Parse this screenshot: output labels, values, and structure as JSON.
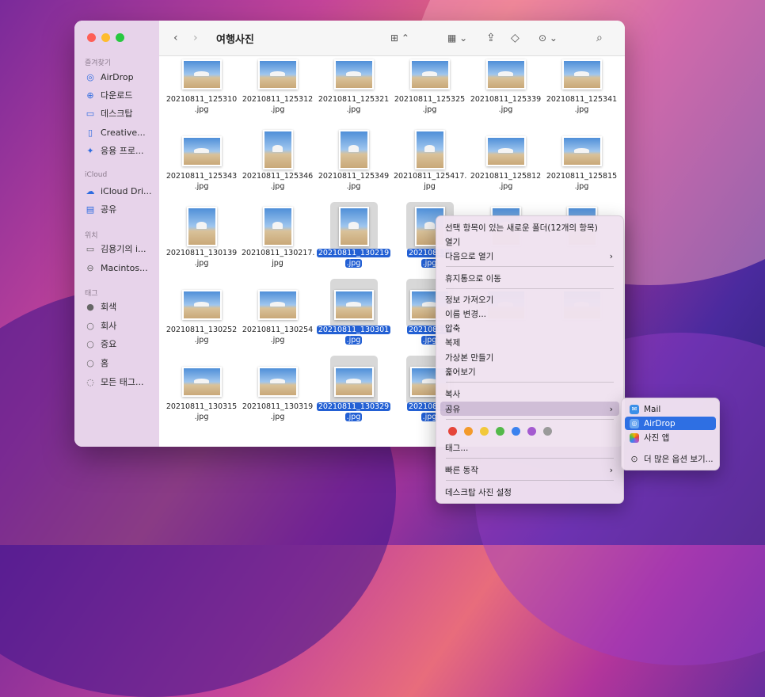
{
  "window": {
    "title": "여행사진"
  },
  "sidebar": {
    "sections": [
      {
        "label": "즐겨찾기",
        "items": [
          {
            "label": "AirDrop",
            "icon": "airdrop-icon"
          },
          {
            "label": "다운로드",
            "icon": "download-icon"
          },
          {
            "label": "데스크탑",
            "icon": "desktop-icon"
          },
          {
            "label": "Creative...",
            "icon": "document-icon"
          },
          {
            "label": "응용 프로...",
            "icon": "applications-icon"
          }
        ]
      },
      {
        "label": "iCloud",
        "items": [
          {
            "label": "iCloud Dri...",
            "icon": "cloud-icon"
          },
          {
            "label": "공유",
            "icon": "shared-folder-icon"
          }
        ]
      },
      {
        "label": "위치",
        "items": [
          {
            "label": "김용기의 i...",
            "icon": "computer-icon"
          },
          {
            "label": "Macintos...",
            "icon": "disk-icon"
          }
        ]
      },
      {
        "label": "태그",
        "items": [
          {
            "label": "회색",
            "icon": "tag-dot-gray-icon"
          },
          {
            "label": "회사",
            "icon": "tag-dot-empty-icon"
          },
          {
            "label": "중요",
            "icon": "tag-dot-empty-icon"
          },
          {
            "label": "홈",
            "icon": "tag-dot-empty-icon"
          },
          {
            "label": "모든 태그...",
            "icon": "all-tags-icon"
          }
        ]
      }
    ]
  },
  "files": [
    {
      "name1": "20210811_125310",
      "name2": ".jpg",
      "selected": false,
      "orient": "landscape"
    },
    {
      "name1": "20210811_125312",
      "name2": ".jpg",
      "selected": false,
      "orient": "landscape"
    },
    {
      "name1": "20210811_125321",
      "name2": ".jpg",
      "selected": false,
      "orient": "landscape"
    },
    {
      "name1": "20210811_125325",
      "name2": ".jpg",
      "selected": false,
      "orient": "landscape"
    },
    {
      "name1": "20210811_125339",
      "name2": ".jpg",
      "selected": false,
      "orient": "landscape"
    },
    {
      "name1": "20210811_125341",
      "name2": ".jpg",
      "selected": false,
      "orient": "landscape"
    },
    {
      "name1": "20210811_125343",
      "name2": ".jpg",
      "selected": false,
      "orient": "landscape"
    },
    {
      "name1": "20210811_125346",
      "name2": ".jpg",
      "selected": false,
      "orient": "portrait"
    },
    {
      "name1": "20210811_125349",
      "name2": ".jpg",
      "selected": false,
      "orient": "portrait"
    },
    {
      "name1": "20210811_125417.",
      "name2": "jpg",
      "selected": false,
      "orient": "portrait"
    },
    {
      "name1": "20210811_125812",
      "name2": ".jpg",
      "selected": false,
      "orient": "landscape"
    },
    {
      "name1": "20210811_125815",
      "name2": ".jpg",
      "selected": false,
      "orient": "landscape"
    },
    {
      "name1": "20210811_130139",
      "name2": ".jpg",
      "selected": false,
      "orient": "portrait"
    },
    {
      "name1": "20210811_130217.",
      "name2": "jpg",
      "selected": false,
      "orient": "portrait"
    },
    {
      "name1": "20210811_130219",
      "name2": ".jpg",
      "selected": true,
      "orient": "portrait"
    },
    {
      "name1": "20210811_",
      "name2": ".jpg",
      "selected": true,
      "orient": "portrait"
    },
    {
      "name1": "",
      "name2": "",
      "selected": false,
      "orient": "portrait"
    },
    {
      "name1": "",
      "name2": "",
      "selected": false,
      "orient": "portrait"
    },
    {
      "name1": "20210811_130252",
      "name2": ".jpg",
      "selected": false,
      "orient": "landscape"
    },
    {
      "name1": "20210811_130254",
      "name2": ".jpg",
      "selected": false,
      "orient": "landscape"
    },
    {
      "name1": "20210811_130301",
      "name2": ".jpg",
      "selected": true,
      "orient": "landscape"
    },
    {
      "name1": "20210811_",
      "name2": ".jpg",
      "selected": true,
      "orient": "landscape"
    },
    {
      "name1": "",
      "name2": "",
      "selected": false,
      "orient": "landscape"
    },
    {
      "name1": "",
      "name2": "",
      "selected": false,
      "orient": "landscape"
    },
    {
      "name1": "20210811_130315",
      "name2": ".jpg",
      "selected": false,
      "orient": "landscape"
    },
    {
      "name1": "20210811_130319",
      "name2": ".jpg",
      "selected": false,
      "orient": "landscape"
    },
    {
      "name1": "20210811_130329",
      "name2": ".jpg",
      "selected": true,
      "orient": "landscape"
    },
    {
      "name1": "20210811_",
      "name2": ".jpg",
      "selected": true,
      "orient": "landscape"
    }
  ],
  "context_menu": {
    "items": [
      {
        "label": "선택 항목이 있는 새로운 폴더(12개의 항목)"
      },
      {
        "label": "열기"
      },
      {
        "label": "다음으로 열기",
        "submenu": true
      },
      {
        "label": "휴지통으로 이동"
      },
      {
        "label": "정보 가져오기"
      },
      {
        "label": "이름 변경..."
      },
      {
        "label": "압축"
      },
      {
        "label": "복제"
      },
      {
        "label": "가상본 만들기"
      },
      {
        "label": "훑어보기"
      },
      {
        "label": "복사"
      },
      {
        "label": "공유",
        "submenu": true,
        "highlighted": true
      },
      {
        "label": "태그..."
      },
      {
        "label": "빠른 동작",
        "submenu": true
      },
      {
        "label": "데스크탑 사진 설정"
      }
    ],
    "tag_colors": [
      "#e5453a",
      "#f39a2b",
      "#f2c83a",
      "#53b94a",
      "#3b82ef",
      "#a45ad0",
      "#9a9a9a"
    ]
  },
  "share_submenu": {
    "items": [
      {
        "label": "Mail",
        "icon": "mail-icon",
        "highlighted": false
      },
      {
        "label": "AirDrop",
        "icon": "airdrop-icon",
        "highlighted": true
      },
      {
        "label": "사진 앱",
        "icon": "photos-icon",
        "highlighted": false
      },
      {
        "label": "더 많은 옵션 보기...",
        "icon": "more-options-icon",
        "highlighted": false
      }
    ]
  }
}
